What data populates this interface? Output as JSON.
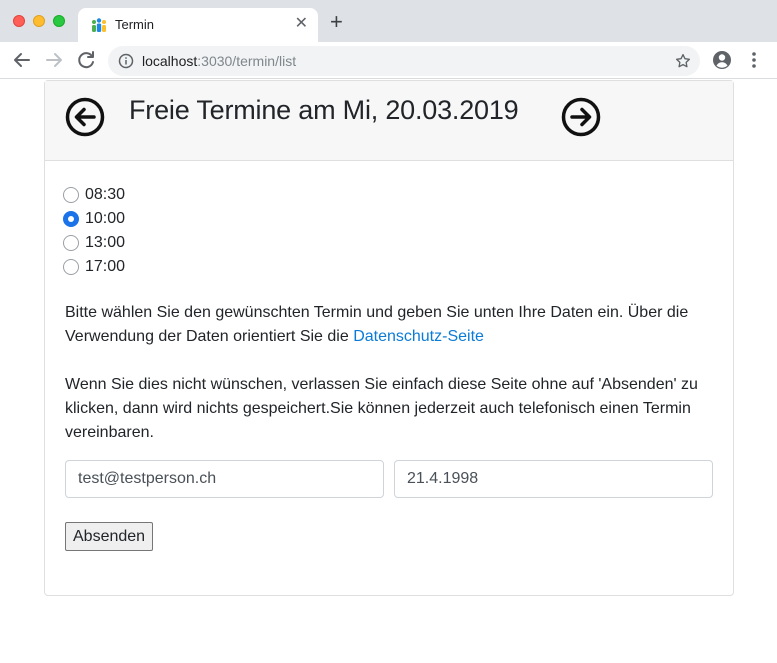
{
  "browser": {
    "tab": {
      "title": "Termin",
      "close_glyph": "✕",
      "favicon": "people-icon"
    },
    "new_tab_glyph": "+",
    "address": {
      "host": "localhost",
      "path": ":3030/termin/list"
    }
  },
  "header": {
    "title": "Freie Termine am Mi, 20.03.2019",
    "prev_icon": "arrow-left-circle-icon",
    "next_icon": "arrow-right-circle-icon"
  },
  "slots": [
    {
      "label": "08:30",
      "checked": false
    },
    {
      "label": "10:00",
      "checked": true
    },
    {
      "label": "13:00",
      "checked": false
    },
    {
      "label": "17:00",
      "checked": false
    }
  ],
  "info": {
    "paragraph1_text": "Bitte wählen Sie den gewünschten Termin und geben Sie unten Ihre Daten ein. Über die Verwendung der Daten orientiert Sie die ",
    "paragraph1_link": "Datenschutz-Seite",
    "paragraph2": "Wenn Sie dies nicht wünschen, verlassen Sie einfach diese Seite ohne auf 'Absenden' zu klicken, dann wird nichts gespeichert.Sie können jederzeit auch telefonisch einen Termin vereinbaren."
  },
  "form": {
    "email_value": "test@testperson.ch",
    "date_value": "21.4.1998",
    "submit_label": "Absenden"
  },
  "colors": {
    "accent": "#1a73e8",
    "link": "#0b7bd8",
    "header_bg": "#f7f7f7"
  }
}
